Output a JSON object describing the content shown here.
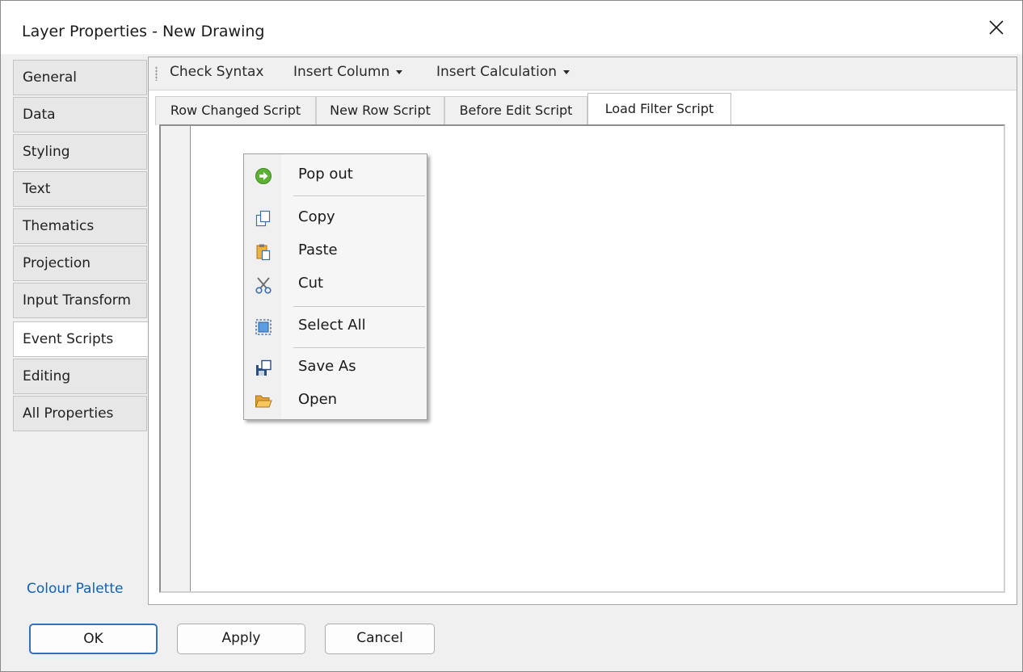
{
  "window": {
    "title": "Layer Properties - New Drawing"
  },
  "sidebar": {
    "items": [
      {
        "label": "General"
      },
      {
        "label": "Data"
      },
      {
        "label": "Styling"
      },
      {
        "label": "Text"
      },
      {
        "label": "Thematics"
      },
      {
        "label": "Projection"
      },
      {
        "label": "Input Transform"
      },
      {
        "label": "Event Scripts",
        "active": true
      },
      {
        "label": "Editing"
      },
      {
        "label": "All Properties"
      }
    ],
    "palette_link": "Colour Palette"
  },
  "toolbar": {
    "check_syntax": "Check Syntax",
    "insert_column": "Insert Column",
    "insert_calculation": "Insert Calculation"
  },
  "tabs": [
    {
      "label": "Row Changed Script"
    },
    {
      "label": "New Row Script"
    },
    {
      "label": "Before Edit Script"
    },
    {
      "label": "Load Filter Script",
      "active": true
    }
  ],
  "context_menu": {
    "items": [
      {
        "label": "Pop out",
        "icon": "pop-out-icon"
      },
      {
        "label": "Copy",
        "icon": "copy-icon"
      },
      {
        "label": "Paste",
        "icon": "paste-icon"
      },
      {
        "label": "Cut",
        "icon": "scissors-icon"
      },
      {
        "label": "Select All",
        "icon": "select-all-icon"
      },
      {
        "label": "Save As",
        "icon": "save-icon"
      },
      {
        "label": "Open",
        "icon": "folder-open-icon"
      }
    ]
  },
  "buttons": {
    "ok": "OK",
    "apply": "Apply",
    "cancel": "Cancel"
  },
  "colors": {
    "accent": "#2f72c4",
    "link": "#0f62b3",
    "popout_green": "#5fb135",
    "folder": "#f2b13a"
  }
}
